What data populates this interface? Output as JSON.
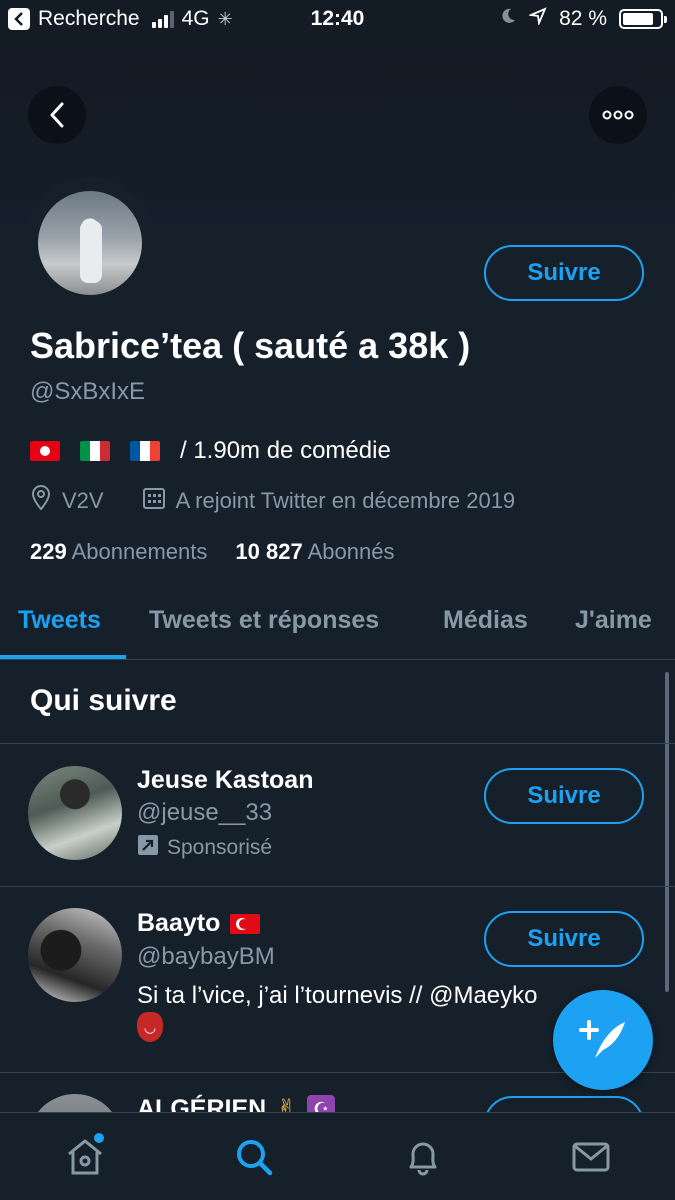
{
  "status_bar": {
    "back_app": "Recherche",
    "network": "4G",
    "time": "12:40",
    "battery": "82 %",
    "battery_fraction": 0.82
  },
  "profile": {
    "display_name": "Sabrice’tea ( sauté a 38k )",
    "handle": "@SxBxIxE",
    "bio_flags": [
      "tunisia-flag",
      "italy-flag",
      "france-flag"
    ],
    "bio_text": "/ 1.90m de comédie",
    "location": "V2V",
    "joined": "A rejoint Twitter en décembre 2019",
    "following_count": "229",
    "following_label": "Abonnements",
    "followers_count": "10 827",
    "followers_label": "Abonnés",
    "follow_label": "Suivre"
  },
  "tabs": [
    {
      "label": "Tweets",
      "active": true
    },
    {
      "label": "Tweets et réponses",
      "active": false
    },
    {
      "label": "Médias",
      "active": false
    },
    {
      "label": "J'aime",
      "active": false
    }
  ],
  "who_to_follow": {
    "title": "Qui suivre",
    "items": [
      {
        "name": "Jeuse Kastoan",
        "handle": "@jeuse__33",
        "sponsored": "Sponsorisé",
        "follow_label": "Suivre"
      },
      {
        "name": "Baayto",
        "name_emoji": "turkey-flag",
        "handle": "@baybayBM",
        "bio": "Si ta l’vice, j’ai l’tournevis // @Maeyko",
        "bio_emoji": "goblin-emoji",
        "follow_label": "Suivre"
      },
      {
        "name": "ALGÉRIEN",
        "name_emoji": "victory-hand, star-and-crescent",
        "follow_label": "Suivre"
      }
    ]
  },
  "colors": {
    "background": "#15202b",
    "accent": "#1da1f2",
    "secondary_text": "#8899a6",
    "divider": "#38444d"
  }
}
